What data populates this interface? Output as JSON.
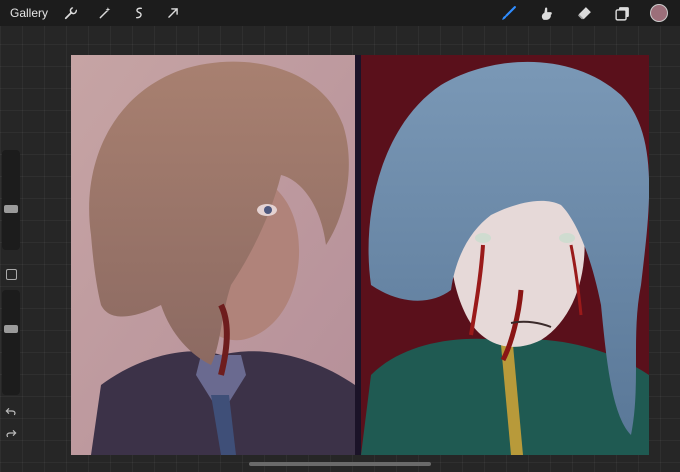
{
  "toolbar": {
    "gallery_label": "Gallery",
    "left_tools": [
      "wrench-icon",
      "magic-wand-icon",
      "selection-icon",
      "transform-arrow-icon"
    ],
    "right_tools": [
      "brush-icon",
      "smudge-icon",
      "eraser-icon",
      "layers-icon"
    ],
    "active_tool": "brush-icon",
    "accent_color": "#2f8cff",
    "current_color": "#9c6f7a"
  },
  "sidebar": {
    "brush_size_level": 0.6,
    "opacity_level": 0.35
  },
  "canvas": {
    "left_panel_bg": "#c4a1a6",
    "right_panel_bg": "#5a101b",
    "divider_color": "#1b1328"
  }
}
